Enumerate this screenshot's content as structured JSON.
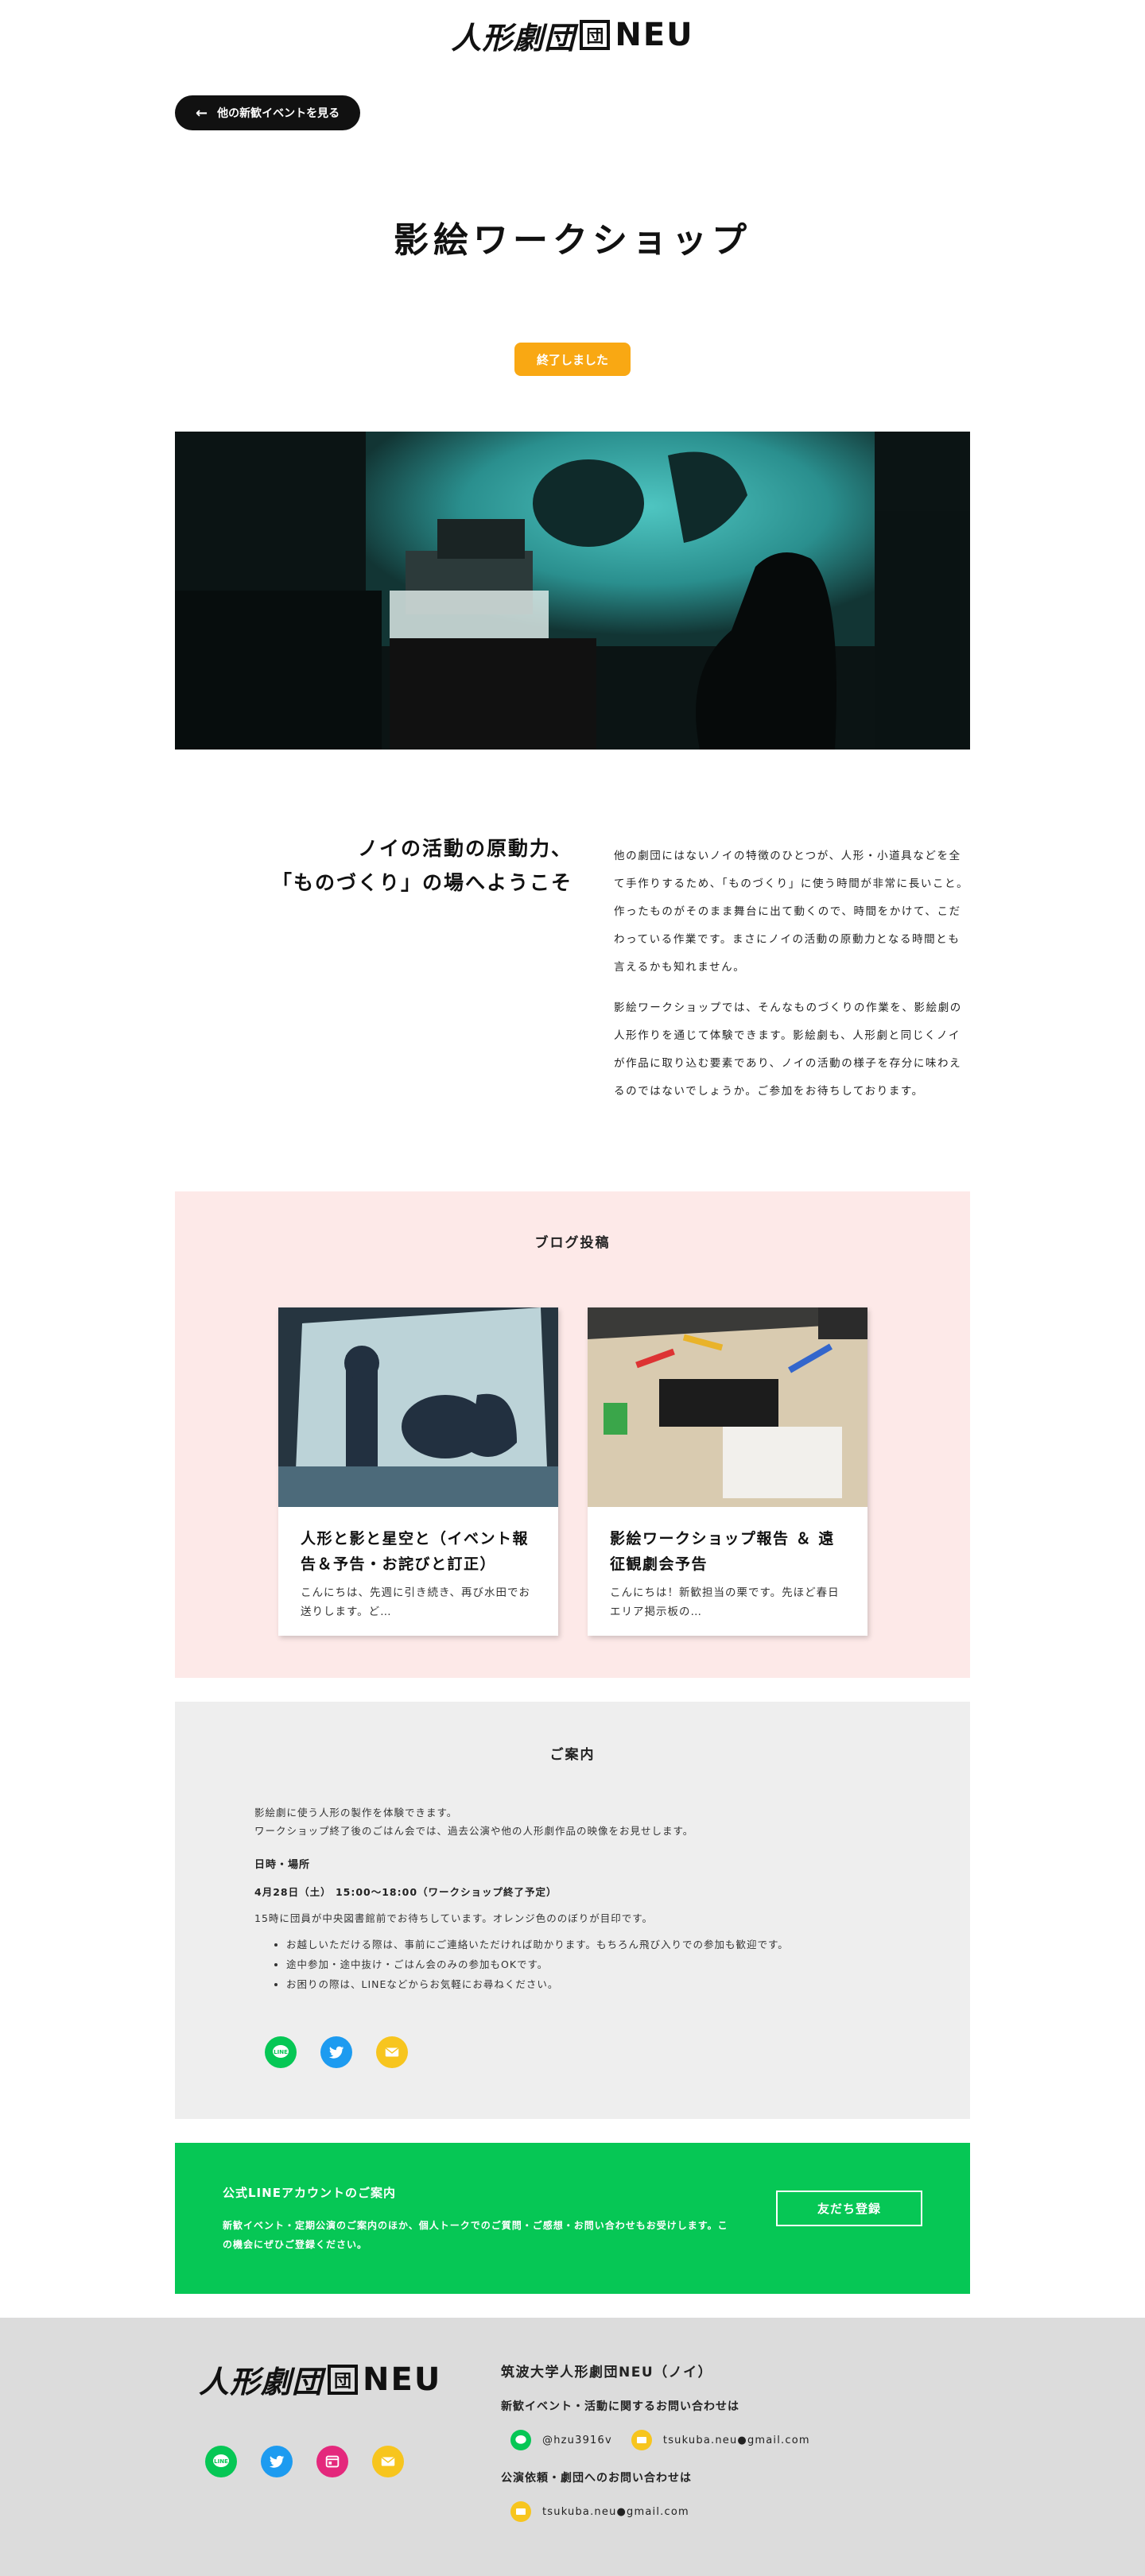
{
  "header": {
    "logo_text": "人形劇団",
    "logo_box": "団",
    "logo_neu": "NEU"
  },
  "nav": {
    "back_label": "他の新歓イベントを見る"
  },
  "event": {
    "title": "影絵ワークショップ",
    "status": "終了しました"
  },
  "intro": {
    "heading_line1": "ノイの活動の原動力、",
    "heading_line2": "「ものづくり」の場へようこそ",
    "paragraph1": "他の劇団にはないノイの特徴のひとつが、人形・小道具などを全て手作りするため、「ものづくり」に使う時間が非常に長いこと。作ったものがそのまま舞台に出て動くので、時間をかけて、こだわっている作業です。まさにノイの活動の原動力となる時間とも言えるかも知れません。",
    "paragraph2": "影絵ワークショップでは、そんなものづくりの作業を、影絵劇の人形作りを通じて体験できます。影絵劇も、人形劇と同じくノイが作品に取り込む要素であり、ノイの活動の様子を存分に味わえるのではないでしょうか。ご参加をお待ちしております。"
  },
  "blog": {
    "title": "ブログ投稿",
    "posts": [
      {
        "title": "人形と影と星空と（イベント報告＆予告・お詫びと訂正）",
        "excerpt": "こんにちは、先週に引き続き、再び水田でお送りします。ど…"
      },
      {
        "title": "影絵ワークショップ報告 ＆ 遠征観劇会予告",
        "excerpt": "こんにちは！新歓担当の栗です。先ほど春日エリア掲示板の…"
      }
    ]
  },
  "info": {
    "title": "ご案内",
    "line1": "影絵劇に使う人形の製作を体験できます。",
    "line2": "ワークショップ終了後のごはん会では、過去公演や他の人形劇作品の映像をお見せします。",
    "datetime_label": "日時・場所",
    "datetime": "4月28日（土） 15:00〜18:00（ワークショップ終了予定）",
    "meeting": "15時に団員が中央図書館前でお待ちしています。オレンジ色ののぼりが目印です。",
    "notes": [
      "お越しいただける際は、事前にご連絡いただければ助かります。もちろん飛び入りでの参加も歓迎です。",
      "途中参加・途中抜け・ごはん会のみの参加もOKです。",
      "お困りの際は、LINEなどからお気軽にお尋ねください。"
    ],
    "share_icons": [
      "line-icon",
      "twitter-icon",
      "mail-icon"
    ]
  },
  "line_banner": {
    "title": "公式LINEアカウントのご案内",
    "description": "新歓イベント・定期公演のご案内のほか、個人トークでのご質問・ご感想・お問い合わせもお受けします。この機会にぜひご登録ください。",
    "button": "友だち登録"
  },
  "footer": {
    "org_name": "筑波大学人形劇団NEU（ノイ）",
    "contact_label": "新歓イベント・活動に関するお問い合わせは",
    "line_id": "@hzu3916v",
    "email": "tsukuba.neu●gmail.com",
    "booking_label": "公演依頼・劇団へのお問い合わせは",
    "booking_email": "tsukuba.neu●gmail.com"
  },
  "colors": {
    "status": "#f9a813",
    "blog_bg": "#fde9e8",
    "info_bg": "#eeeeee",
    "line_green": "#06c755",
    "twitter_blue": "#1d9bf0",
    "mail_yellow": "#f7c51e",
    "instagram_pink": "#e4287c",
    "footer_bg": "#dcdcdc"
  }
}
